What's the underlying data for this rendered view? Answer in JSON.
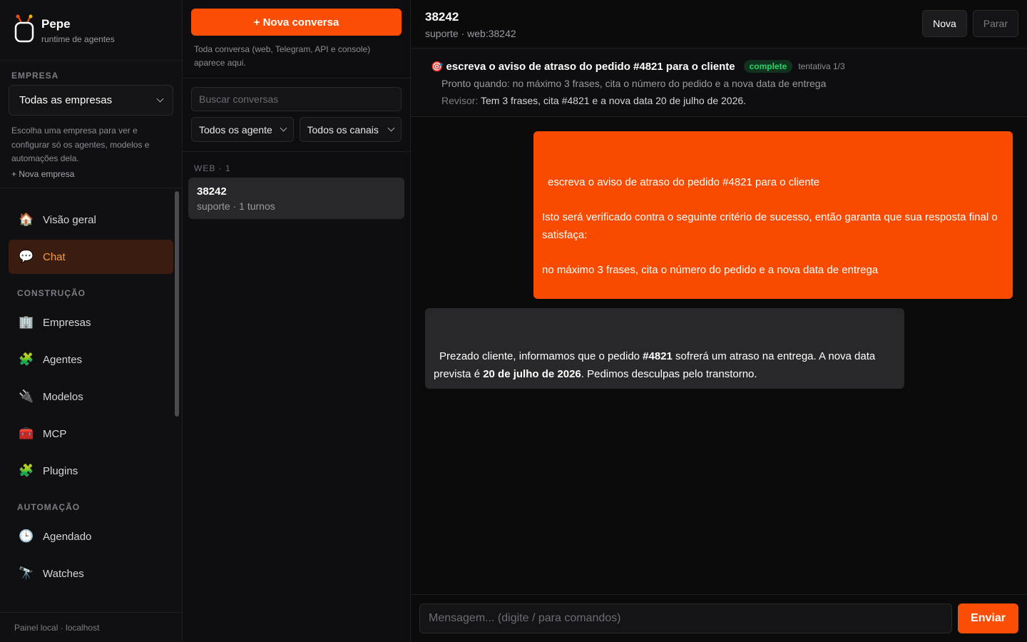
{
  "brand": {
    "name": "Pepe",
    "subtitle": "runtime de agentes"
  },
  "company": {
    "label": "EMPRESA",
    "selected": "Todas as empresas",
    "hint": "Escolha uma empresa para ver e configurar só os agentes, modelos e automações dela.",
    "new_link": "+ Nova empresa"
  },
  "nav": {
    "main": [
      {
        "label": "Visão geral",
        "icon": "house-icon"
      },
      {
        "label": "Chat",
        "icon": "chat-bubble-icon",
        "active": true
      }
    ],
    "construction_label": "CONSTRUÇÃO",
    "construction": [
      {
        "label": "Empresas",
        "icon": "office-building-icon"
      },
      {
        "label": "Agentes",
        "icon": "puzzle-icon"
      },
      {
        "label": "Modelos",
        "icon": "plug-icon"
      },
      {
        "label": "MCP",
        "icon": "toolbox-icon"
      },
      {
        "label": "Plugins",
        "icon": "puzzle-icon"
      }
    ],
    "automation_label": "AUTOMAÇÃO",
    "automation": [
      {
        "label": "Agendado",
        "icon": "clock-icon"
      },
      {
        "label": "Watches",
        "icon": "telescope-icon"
      }
    ]
  },
  "footer": "Painel local · localhost",
  "conversations": {
    "new_button": "+ Nova conversa",
    "hint": "Toda conversa (web, Telegram, API e console) aparece aqui.",
    "search_placeholder": "Buscar conversas",
    "filter_agents": "Todos os agentes",
    "filter_channels": "Todos os canais",
    "group_label": "WEB · 1",
    "items": [
      {
        "title": "38242",
        "subtitle": "suporte · 1 turnos"
      }
    ]
  },
  "chat": {
    "title": "38242",
    "subtitle": "suporte · web:38242",
    "btn_new": "Nova",
    "btn_stop": "Parar",
    "goal": {
      "title": "escreva o aviso de atraso do pedido #4821 para o cliente",
      "status": "complete",
      "attempt": "tentativa 1/3",
      "criterion": "Pronto quando: no máximo 3 frases, cita o número do pedido e a nova data de entrega",
      "reviewer_label": "Revisor:",
      "reviewer_text": "Tem 3 frases, cita #4821 e a nova data 20 de julho de 2026."
    },
    "user_message": {
      "line1": "escreva o aviso de atraso do pedido #4821 para o cliente",
      "line2": "Isto será verificado contra o seguinte critério de sucesso, então garanta que sua resposta final o satisfaça:",
      "line3": "no máximo 3 frases, cita o número do pedido e a nova data de entrega"
    },
    "bot_message": {
      "part1": "Prezado cliente, informamos que o pedido ",
      "bold1": "#4821",
      "part2": " sofrerá um atraso na entrega. A nova data prevista é ",
      "bold2": "20 de julho de 2026",
      "part3": ". Pedimos desculpas pelo transtorno."
    },
    "input_placeholder": "Mensagem...  (digite / para comandos)",
    "send_label": "Enviar"
  },
  "colors": {
    "accent": "#fa4d05",
    "active_nav_bg": "#3a1d10",
    "active_nav_text": "#ff9a3c",
    "status_green": "#25d46a"
  }
}
